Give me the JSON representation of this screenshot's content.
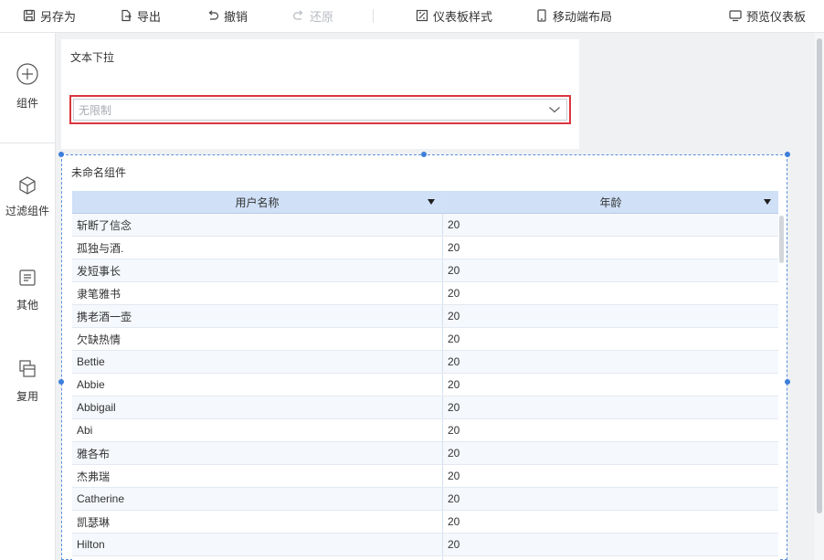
{
  "toolbar": {
    "save_as": "另存为",
    "export": "导出",
    "undo": "撤销",
    "redo": "还原",
    "dashboard_style": "仪表板样式",
    "mobile_layout": "移动端布局",
    "preview": "预览仪表板"
  },
  "sidebar": {
    "items": [
      {
        "label": "组件",
        "icon": "plus-circle-icon"
      },
      {
        "label": "过滤组件",
        "icon": "cube-icon"
      },
      {
        "label": "其他",
        "icon": "document-icon"
      },
      {
        "label": "复用",
        "icon": "stack-icon"
      }
    ]
  },
  "filter_widget": {
    "title": "文本下拉",
    "select_value": "无限制"
  },
  "table_widget": {
    "title": "未命名组件",
    "columns": [
      "用户名称",
      "年龄"
    ],
    "rows": [
      [
        "斩断了信念",
        "20"
      ],
      [
        "孤独与酒.",
        "20"
      ],
      [
        "发短事长",
        "20"
      ],
      [
        "隶笔雅书",
        "20"
      ],
      [
        "携老酒一壶",
        "20"
      ],
      [
        "欠缺热情",
        "20"
      ],
      [
        "Bettie",
        "20"
      ],
      [
        "Abbie",
        "20"
      ],
      [
        "Abbigail",
        "20"
      ],
      [
        "Abi",
        "20"
      ],
      [
        "雅各布",
        "20"
      ],
      [
        "杰弗瑞",
        "20"
      ],
      [
        "Catherine",
        "20"
      ],
      [
        "凯瑟琳",
        "20"
      ],
      [
        "Hilton",
        "20"
      ],
      [
        "",
        ""
      ]
    ]
  },
  "colors": {
    "accent": "#3d7fdb",
    "header_bg": "#cfe0f7",
    "highlight_border": "#d9363e"
  }
}
